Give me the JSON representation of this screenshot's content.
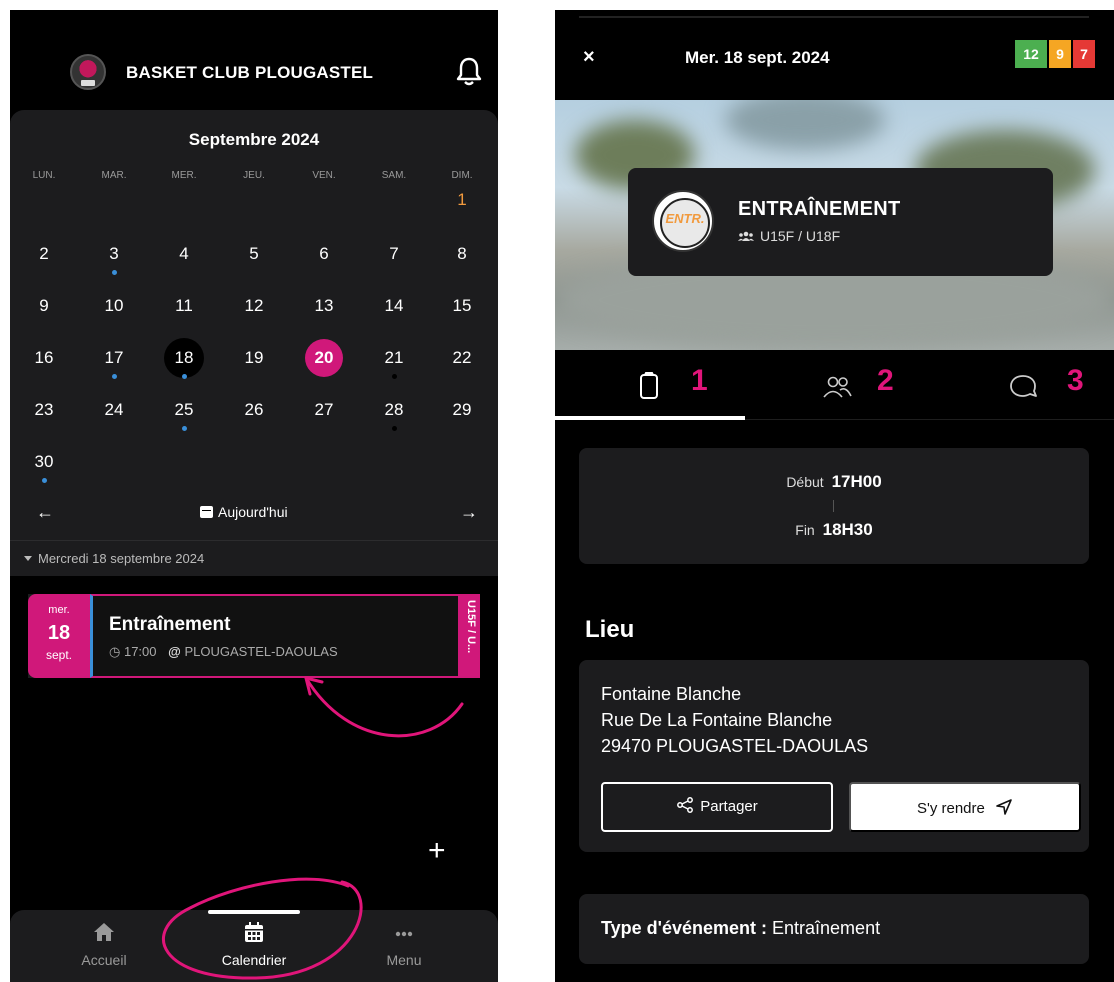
{
  "left": {
    "header": {
      "club_name": "BASKET CLUB PLOUGASTEL"
    },
    "calendar": {
      "month_title": "Septembre 2024",
      "weekdays": [
        "LUN.",
        "MAR.",
        "MER.",
        "JEU.",
        "VEN.",
        "SAM.",
        "DIM."
      ],
      "days": [
        "1",
        "2",
        "3",
        "4",
        "5",
        "6",
        "7",
        "8",
        "9",
        "10",
        "11",
        "12",
        "13",
        "14",
        "15",
        "16",
        "17",
        "18",
        "19",
        "20",
        "21",
        "22",
        "23",
        "24",
        "25",
        "26",
        "27",
        "28",
        "29",
        "30"
      ],
      "first_weekday_index": 6,
      "selected_day": "18",
      "today_day": "20",
      "days_with_blue_dot": [
        "3",
        "17",
        "18",
        "25",
        "30"
      ],
      "days_with_dark_dot": [
        "21",
        "28"
      ],
      "highlighted_orange_day": "1",
      "prev_arrow": "←",
      "next_arrow": "→",
      "today_button": "Aujourd'hui"
    },
    "date_section": {
      "label": "Mercredi 18 septembre 2024"
    },
    "event": {
      "weekday": "mer.",
      "day": "18",
      "month": "sept.",
      "title": "Entraînement",
      "time": "17:00",
      "location": "PLOUGASTEL-DAOULAS",
      "tag": "U15F / U...",
      "accent_color": "#d0187a"
    },
    "fab": {
      "label": "+"
    },
    "bottom_nav": {
      "items": [
        {
          "label": "Accueil",
          "icon": "home-icon"
        },
        {
          "label": "Calendrier",
          "icon": "calendar-icon"
        },
        {
          "label": "Menu",
          "icon": "more-icon"
        }
      ]
    }
  },
  "right": {
    "header": {
      "close": "×",
      "date": "Mer. 18 sept. 2024",
      "counters": [
        {
          "value": "12",
          "color": "#4caf50"
        },
        {
          "value": "9",
          "color": "#f5a623"
        },
        {
          "value": "7",
          "color": "#e53935"
        }
      ]
    },
    "event_head": {
      "badge": "ENTR.",
      "title": "ENTRAÎNEMENT",
      "teams": "U15F / U18F"
    },
    "tabs": [
      {
        "number": "1",
        "icon": "clipboard-icon"
      },
      {
        "number": "2",
        "icon": "people-icon"
      },
      {
        "number": "3",
        "icon": "chat-icon"
      }
    ],
    "time": {
      "start_label": "Début",
      "start_value": "17H00",
      "end_label": "Fin",
      "end_value": "18H30"
    },
    "place": {
      "heading": "Lieu",
      "line1": "Fontaine Blanche",
      "line2": "Rue De La Fontaine Blanche",
      "line3": "29470 PLOUGASTEL-DAOULAS",
      "share_label": "Partager",
      "go_label": "S'y rendre"
    },
    "type": {
      "label": "Type d'événement :",
      "value": "Entraînement"
    },
    "annotation_color": "#e0157a"
  }
}
